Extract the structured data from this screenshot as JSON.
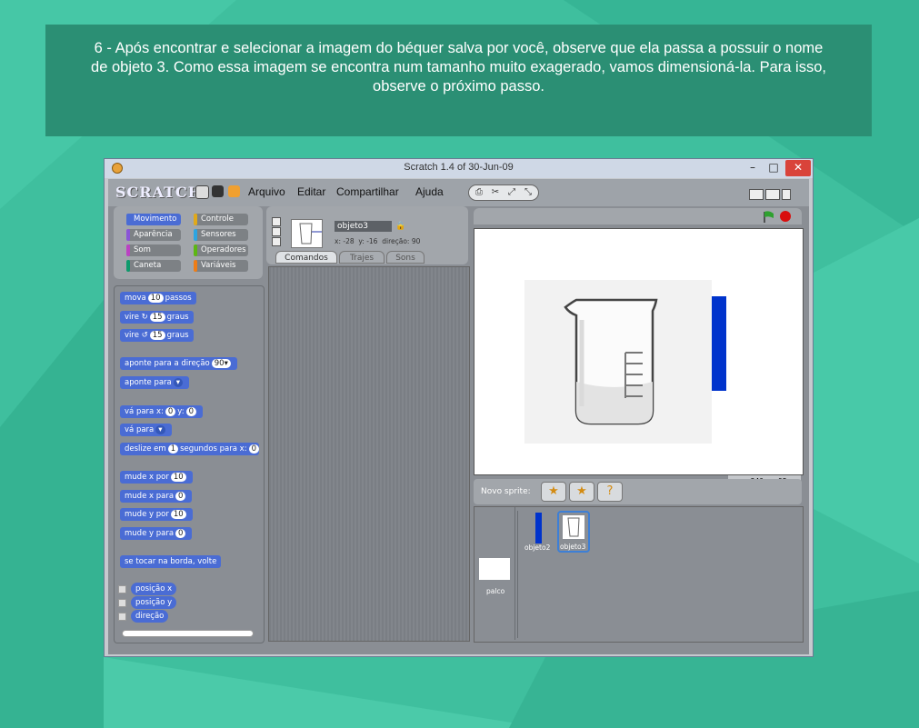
{
  "caption": "6 - Após encontrar e selecionar a imagem do béquer salva por você, observe que ela passa a possuir o nome de objeto 3. Como essa imagem se encontra num tamanho muito exagerado, vamos dimensioná-la. Para isso, observe o próximo passo.",
  "window": {
    "title": "Scratch 1.4 of 30-Jun-09",
    "min": "–",
    "max": "□",
    "close": "✕"
  },
  "app": {
    "logo": "SCRATCH",
    "menu": [
      "Arquivo",
      "Editar",
      "Compartilhar",
      "Ajuda"
    ],
    "categories": [
      {
        "label": "Movimento",
        "color": "#4a6cd4",
        "selected": true
      },
      {
        "label": "Controle",
        "color": "#e1a91a"
      },
      {
        "label": "Aparência",
        "color": "#8a55d7"
      },
      {
        "label": "Sensores",
        "color": "#2ca5e2"
      },
      {
        "label": "Som",
        "color": "#bb42c3"
      },
      {
        "label": "Operadores",
        "color": "#5cb712"
      },
      {
        "label": "Caneta",
        "color": "#0e9a6c"
      },
      {
        "label": "Variáveis",
        "color": "#ee7d16"
      }
    ],
    "blocks": {
      "mova": {
        "a": "mova",
        "v": "10",
        "b": "passos"
      },
      "vire_r": {
        "a": "vire ↻",
        "v": "15",
        "b": "graus"
      },
      "vire_l": {
        "a": "vire ↺",
        "v": "15",
        "b": "graus"
      },
      "aponte_dir": {
        "a": "aponte para a direção",
        "v": "90▾"
      },
      "aponte_para": {
        "a": "aponte para",
        "v": "▾"
      },
      "va_xy": {
        "a": "vá para x:",
        "x": "0",
        "m": "y:",
        "y": "0"
      },
      "va_para": {
        "a": "vá para",
        "v": "▾"
      },
      "deslize": {
        "a": "deslize em",
        "v": "1",
        "b": "segundos para x:",
        "x": "0",
        "c": "y"
      },
      "mude_x_por": {
        "a": "mude x por",
        "v": "10"
      },
      "mude_x_para": {
        "a": "mude x para",
        "v": "0"
      },
      "mude_y_por": {
        "a": "mude y por",
        "v": "10"
      },
      "mude_y_para": {
        "a": "mude y para",
        "v": "0"
      },
      "borda": {
        "a": "se tocar na borda, volte"
      },
      "posx": "posição x",
      "posy": "posição y",
      "direcao": "direção"
    },
    "sprite": {
      "name": "objeto3",
      "x_label": "x:",
      "x": "-28",
      "y_label": "y:",
      "y": "-16",
      "dir_label": "direção:",
      "dir": "90"
    },
    "tabs": [
      "Comandos",
      "Trajes",
      "Sons"
    ],
    "stage_mouse": {
      "x_label": "x:",
      "x": "240",
      "y_label": "y:",
      "y": "95"
    },
    "novos_sprites": "Novo sprite:",
    "sprite_list": [
      "objeto2",
      "objeto3"
    ],
    "palco": "palco"
  }
}
